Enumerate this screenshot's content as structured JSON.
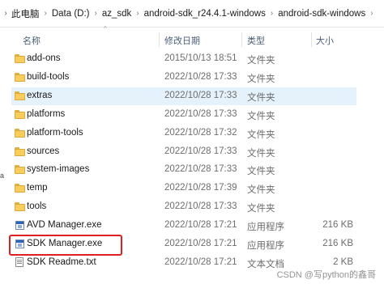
{
  "address_bar": {
    "segments": [
      "此电脑",
      "Data (D:)",
      "az_sdk",
      "android-sdk_r24.4.1-windows",
      "android-sdk-windows"
    ]
  },
  "columns": {
    "name": "名称",
    "date": "修改日期",
    "type": "类型",
    "size": "大小"
  },
  "files": [
    {
      "name": "add-ons",
      "date": "2015/10/13 18:51",
      "type": "文件夹",
      "size": "",
      "kind": "folder"
    },
    {
      "name": "build-tools",
      "date": "2022/10/28 17:33",
      "type": "文件夹",
      "size": "",
      "kind": "folder"
    },
    {
      "name": "extras",
      "date": "2022/10/28 17:33",
      "type": "文件夹",
      "size": "",
      "kind": "folder",
      "selected": true
    },
    {
      "name": "platforms",
      "date": "2022/10/28 17:33",
      "type": "文件夹",
      "size": "",
      "kind": "folder"
    },
    {
      "name": "platform-tools",
      "date": "2022/10/28 17:32",
      "type": "文件夹",
      "size": "",
      "kind": "folder"
    },
    {
      "name": "sources",
      "date": "2022/10/28 17:33",
      "type": "文件夹",
      "size": "",
      "kind": "folder"
    },
    {
      "name": "system-images",
      "date": "2022/10/28 17:33",
      "type": "文件夹",
      "size": "",
      "kind": "folder"
    },
    {
      "name": "temp",
      "date": "2022/10/28 17:39",
      "type": "文件夹",
      "size": "",
      "kind": "folder"
    },
    {
      "name": "tools",
      "date": "2022/10/28 17:33",
      "type": "文件夹",
      "size": "",
      "kind": "folder"
    },
    {
      "name": "AVD Manager.exe",
      "date": "2022/10/28 17:21",
      "type": "应用程序",
      "size": "216 KB",
      "kind": "exe"
    },
    {
      "name": "SDK Manager.exe",
      "date": "2022/10/28 17:21",
      "type": "应用程序",
      "size": "216 KB",
      "kind": "exe",
      "highlighted": true
    },
    {
      "name": "SDK Readme.txt",
      "date": "2022/10/28 17:21",
      "type": "文本文档",
      "size": "2 KB",
      "kind": "txt"
    }
  ],
  "sidebar_fragment": "a",
  "watermark": "CSDN @写python的鑫哥",
  "colors": {
    "selected_row": "#e5f1fb",
    "highlight_box": "#e02020",
    "folder": "#f8cd5c"
  }
}
